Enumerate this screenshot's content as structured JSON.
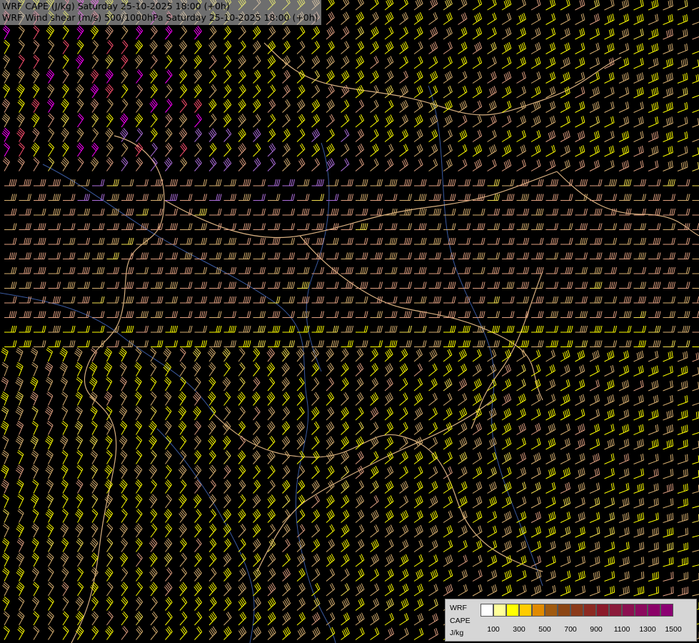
{
  "title": {
    "line1": "WRF CAPE (J/kg) Saturday 25-10-2025 18:00 (+0h)",
    "line2": "WRF Wind shear (m/s) 500/1000hPa Saturday 25-10-2025 18:00 (+0h)"
  },
  "legend": {
    "label_model": "WRF",
    "label_var": "CAPE",
    "label_unit": "J/kg",
    "colors": [
      "#ffffff",
      "#ffff99",
      "#ffff00",
      "#ffcc00",
      "#e08a00",
      "#a05a10",
      "#8b4513",
      "#8b3a1a",
      "#8b2a22",
      "#8b1a2a",
      "#8b1a3a",
      "#8b1050",
      "#8b0a5e",
      "#8b0068",
      "#8b0072"
    ],
    "ticks": [
      "100",
      "300",
      "500",
      "700",
      "900",
      "1100",
      "1300",
      "1500"
    ]
  },
  "map": {
    "background": "#000000",
    "barb_colors": [
      "#ffff00",
      "#d8b070",
      "#e0a080",
      "#b070e0",
      "#ff5070",
      "#ff00ff",
      "#f5e050"
    ],
    "border_color": "#d8b080",
    "river_color": "#3a5aa0"
  }
}
